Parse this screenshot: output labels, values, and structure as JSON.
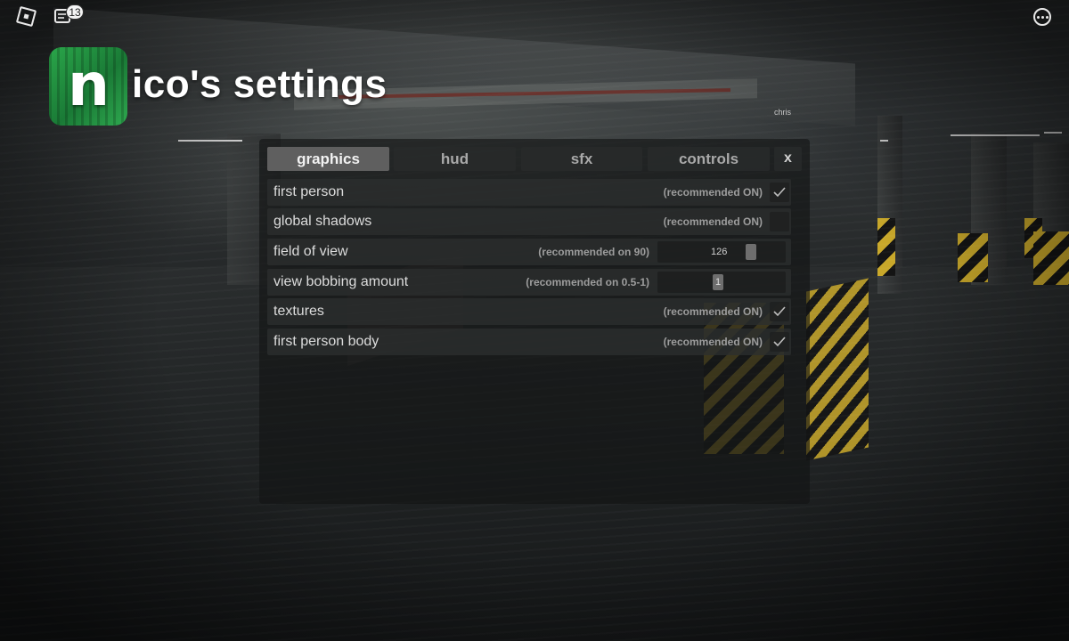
{
  "topbar": {
    "chat_badge": "13"
  },
  "header": {
    "logo_letter": "n",
    "title": "ico's settings",
    "author": "chris"
  },
  "tabs": [
    {
      "label": "graphics",
      "active": true
    },
    {
      "label": "hud",
      "active": false
    },
    {
      "label": "sfx",
      "active": false
    },
    {
      "label": "controls",
      "active": false
    }
  ],
  "close_label": "x",
  "settings": [
    {
      "label": "first person",
      "recommendation": "(recommended ON)",
      "type": "toggle",
      "checked": true
    },
    {
      "label": "global shadows",
      "recommendation": "(recommended ON)",
      "type": "toggle",
      "checked": false
    },
    {
      "label": "field of view",
      "recommendation": "(recommended on 90)",
      "type": "slider",
      "value": "126",
      "fraction": 0.75
    },
    {
      "label": "view bobbing amount",
      "recommendation": "(recommended on 0.5-1)",
      "type": "slider",
      "value": "1",
      "fraction": 0.47
    },
    {
      "label": "textures",
      "recommendation": "(recommended ON)",
      "type": "toggle",
      "checked": true
    },
    {
      "label": "first person body",
      "recommendation": "(recommended ON)",
      "type": "toggle",
      "checked": true
    }
  ],
  "colors": {
    "active_tab": "#5f5f5f",
    "panel_bg": "#121313",
    "logo_green": "#2aa64a"
  }
}
